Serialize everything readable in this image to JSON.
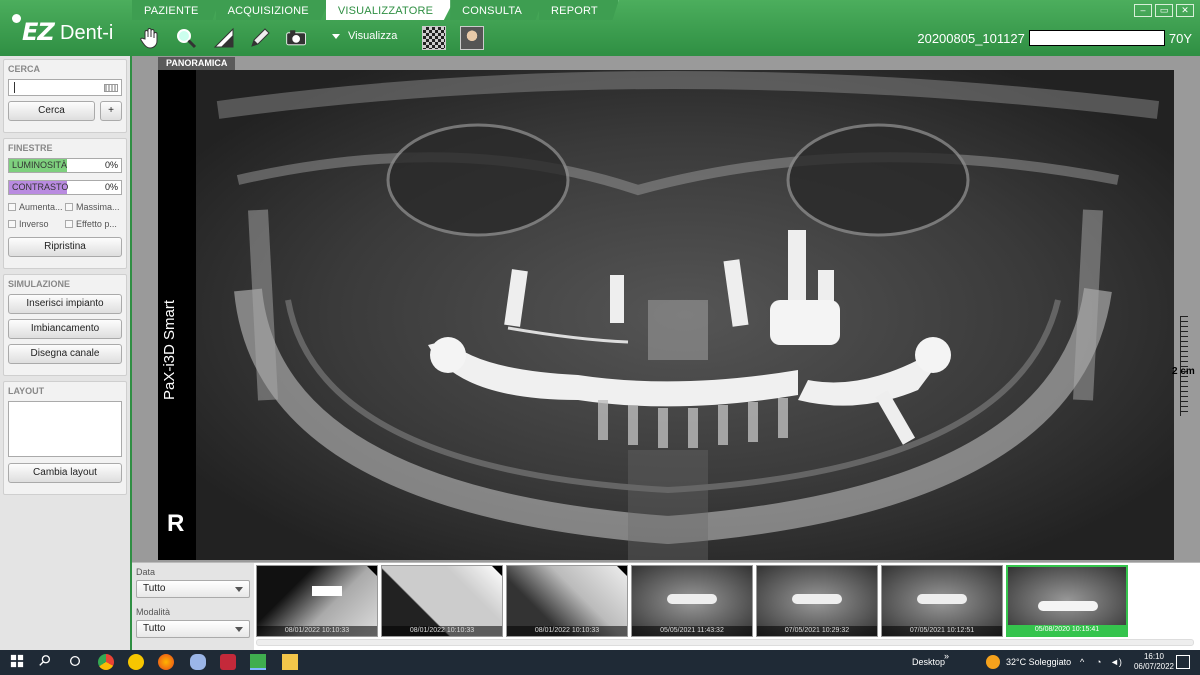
{
  "app": {
    "logo_main": "EZ",
    "logo_sub": "Dent-i"
  },
  "tabs": [
    {
      "label": "PAZIENTE"
    },
    {
      "label": "ACQUISIZIONE"
    },
    {
      "label": "VISUALIZZATORE",
      "active": true
    },
    {
      "label": "CONSULTA"
    },
    {
      "label": "REPORT"
    }
  ],
  "toolbar": {
    "tools": [
      "hand-icon",
      "magnifier-icon",
      "ruler-triangle-icon",
      "pencil-icon",
      "camera-rotate-icon"
    ],
    "visualizza_label": "Visualizza"
  },
  "patient": {
    "id": "20200805_101127",
    "age": "70Y"
  },
  "left": {
    "cerca": {
      "title": "CERCA",
      "search_value": "",
      "search_btn": "Cerca",
      "add_btn": "+"
    },
    "finestre": {
      "title": "FINESTRE",
      "luminosita": {
        "label": "LUMINOSITÀ",
        "value": "0%",
        "color": "#7ed07e"
      },
      "contrasto": {
        "label": "CONTRASTO",
        "value": "0%",
        "color": "#b98be0"
      },
      "checks": [
        "Aumenta...",
        "Massima...",
        "Inverso",
        "Effetto p..."
      ],
      "reset_btn": "Ripristina"
    },
    "simulazione": {
      "title": "SIMULAZIONE",
      "buttons": [
        "Inserisci impianto",
        "Imbiancamento",
        "Disegna canale"
      ]
    },
    "layout": {
      "title": "LAYOUT",
      "button": "Cambia layout"
    }
  },
  "viewer": {
    "view_label": "PANORAMICA",
    "device": "PaX-i3D Smart",
    "side_marker": "R",
    "ruler_label": "2 cm"
  },
  "filters": {
    "data_label": "Data",
    "data_value": "Tutto",
    "modalita_label": "Modalità",
    "modalita_value": "Tutto"
  },
  "thumbnails": [
    {
      "date": "08/01/2022 10:10:33",
      "kind": "intraoral"
    },
    {
      "date": "08/01/2022 10:10:33",
      "kind": "intraoral"
    },
    {
      "date": "08/01/2022 10:10:33",
      "kind": "intraoral"
    },
    {
      "date": "05/05/2021 11:43:32",
      "kind": "pano"
    },
    {
      "date": "07/05/2021 10:29:32",
      "kind": "pano"
    },
    {
      "date": "07/05/2021 10:12:51",
      "kind": "pano"
    },
    {
      "date": "05/08/2020 10:15:41",
      "kind": "pano",
      "selected": true
    }
  ],
  "taskbar": {
    "desktop": "Desktop",
    "weather": "32°C  Soleggiato",
    "time": "16:10",
    "date": "06/07/2022"
  }
}
